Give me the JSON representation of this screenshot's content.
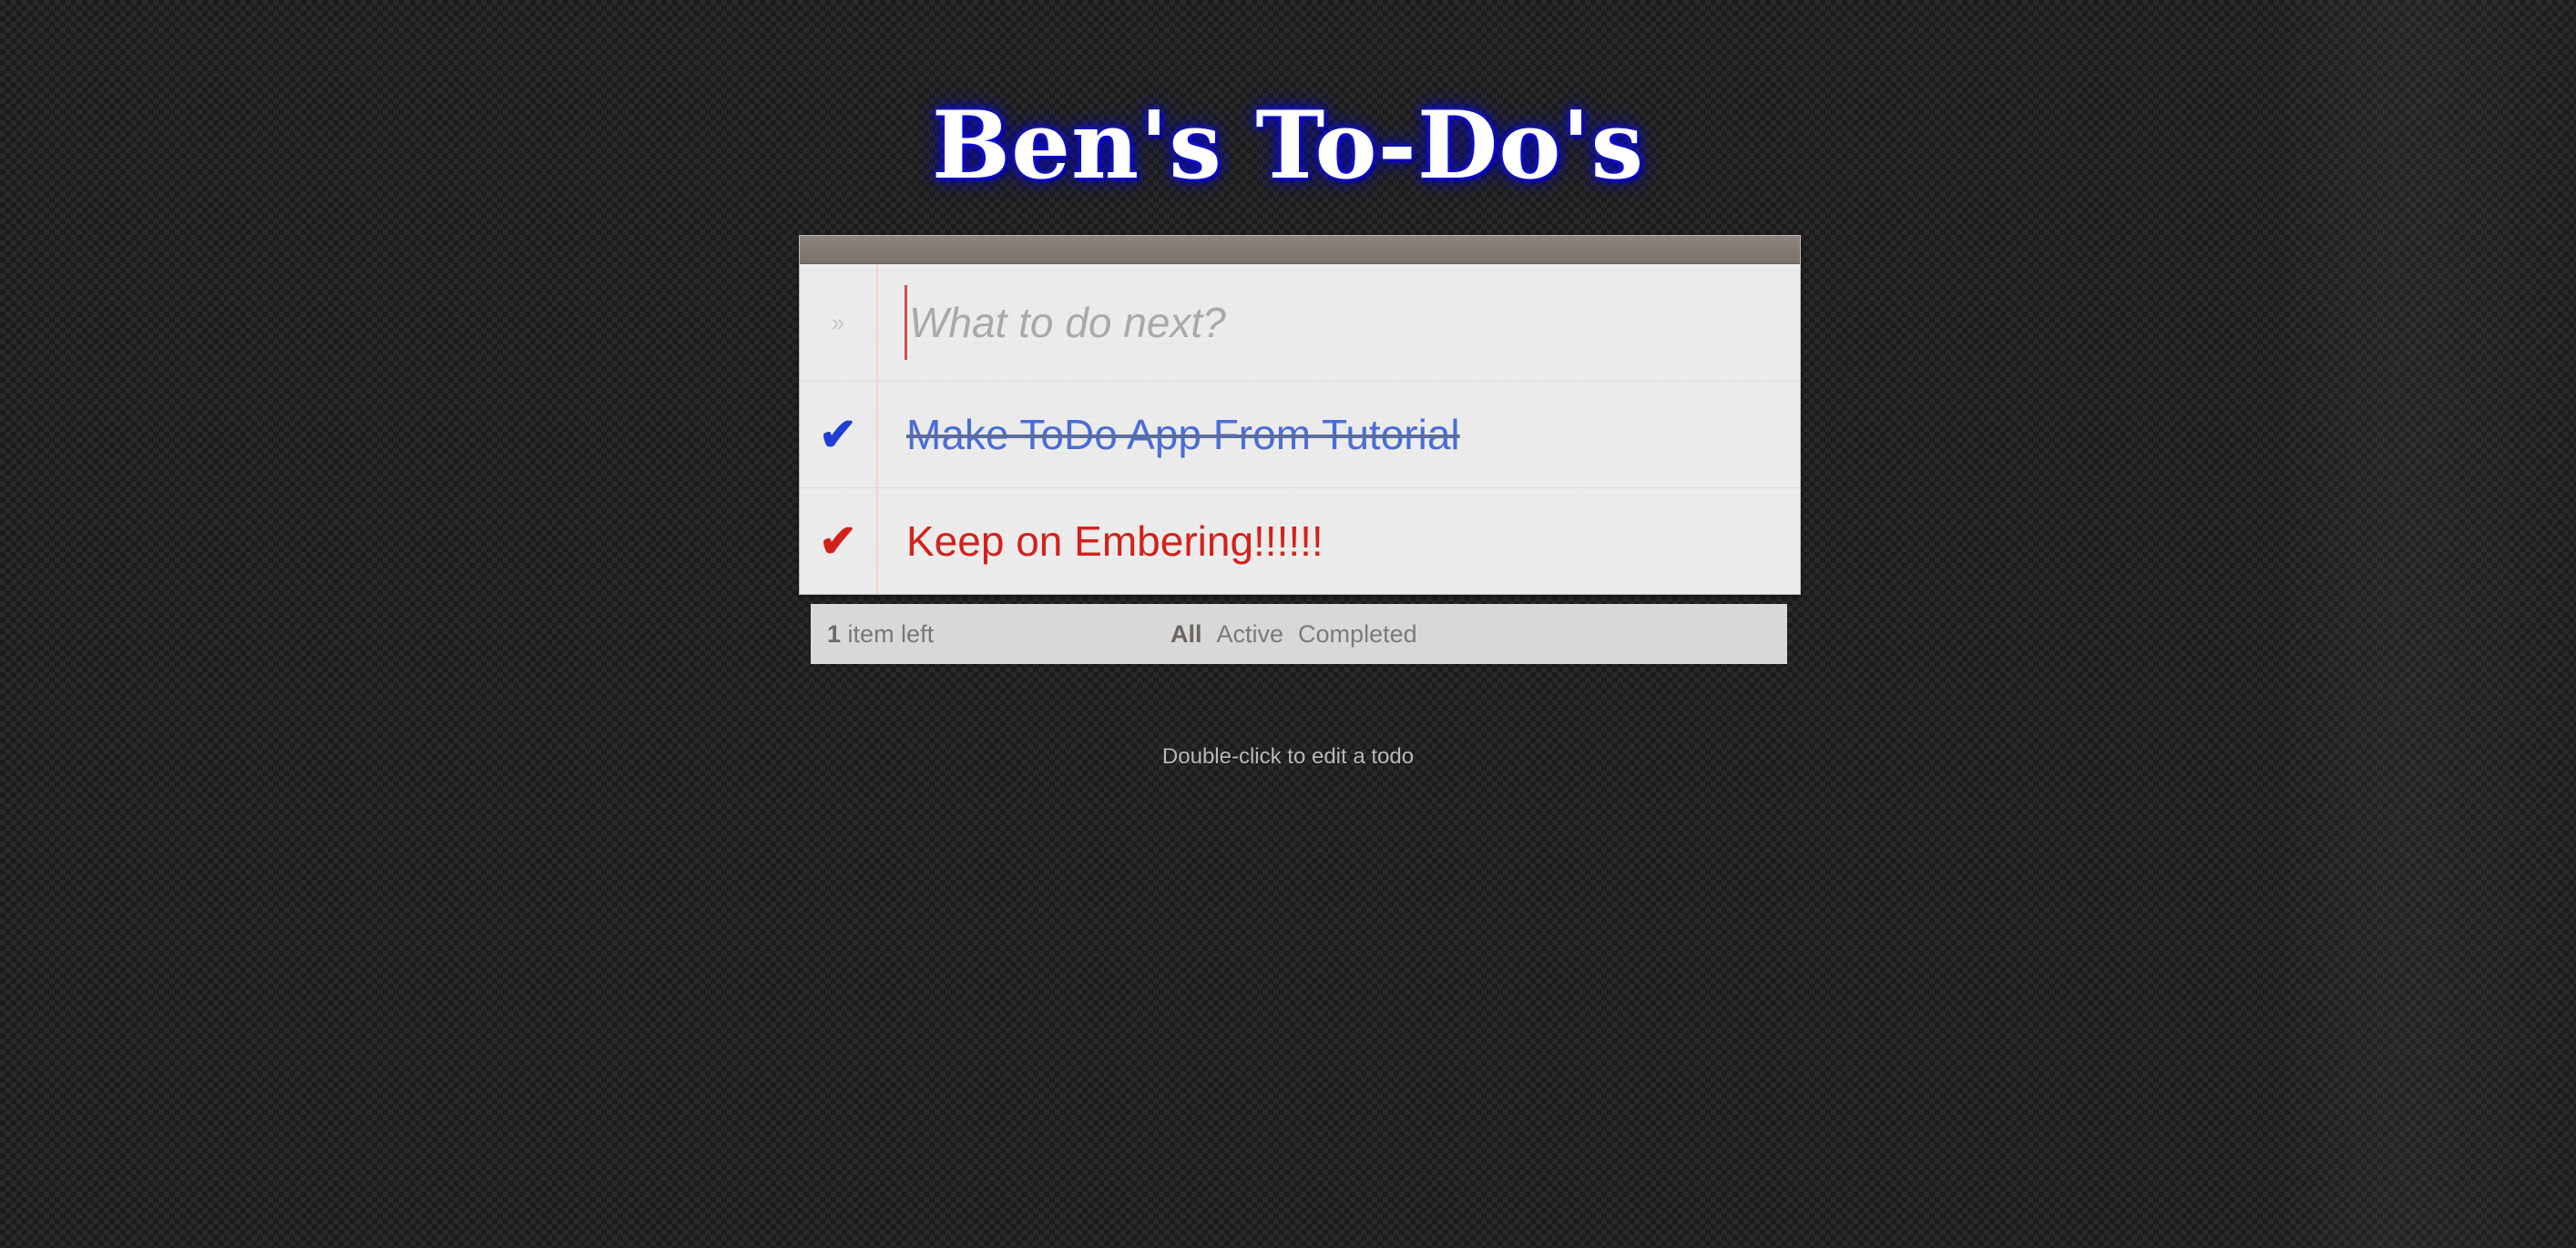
{
  "app": {
    "title": "Ben's To-Do's"
  },
  "new_todo": {
    "placeholder": "What to do next?",
    "value": "",
    "toggle_all_icon": "chevron-double-down-icon"
  },
  "todos": [
    {
      "label": "Make ToDo App From Tutorial",
      "completed": true,
      "check_icon": "checkmark-icon",
      "color": "#1f3fd6"
    },
    {
      "label": "Keep on Embering!!!!!!",
      "completed": false,
      "check_icon": "checkmark-icon",
      "color": "#d3221b"
    }
  ],
  "footer": {
    "count": "1",
    "count_suffix": "item left",
    "filters": {
      "all": "All",
      "active": "Active",
      "completed": "Completed",
      "selected": "All"
    }
  },
  "info": {
    "hint": "Double-click to edit a todo"
  },
  "colors": {
    "title_glow": "#0000cc",
    "header_bar": "#857a75",
    "completed_text": "#4a6dd6",
    "active_text": "#d3221b"
  }
}
